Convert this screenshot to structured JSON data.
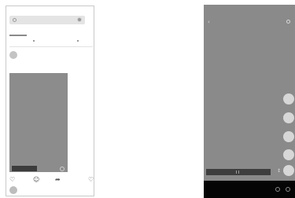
{
  "feed": {
    "search": {
      "icon": "search-icon",
      "settings_icon": "settings-icon"
    },
    "tabs": {
      "indicator": "active-tab-underline"
    },
    "post": {
      "refresh_icon": "refresh-icon"
    },
    "actions": [
      {
        "icon": "heart-icon",
        "glyph": "♡"
      },
      {
        "icon": "comment-icon",
        "glyph": "☺"
      },
      {
        "icon": "share-icon",
        "glyph": "➦"
      },
      {
        "icon": "like-outline-icon",
        "glyph": "♡"
      }
    ]
  },
  "viewer": {
    "back_icon": "chevron-left-icon",
    "back_glyph": "‹",
    "search_icon": "search-icon",
    "side_buttons": 5,
    "mini_icon_glyph": "↕",
    "bottom_icons": [
      "compass-icon",
      "power-icon"
    ]
  }
}
